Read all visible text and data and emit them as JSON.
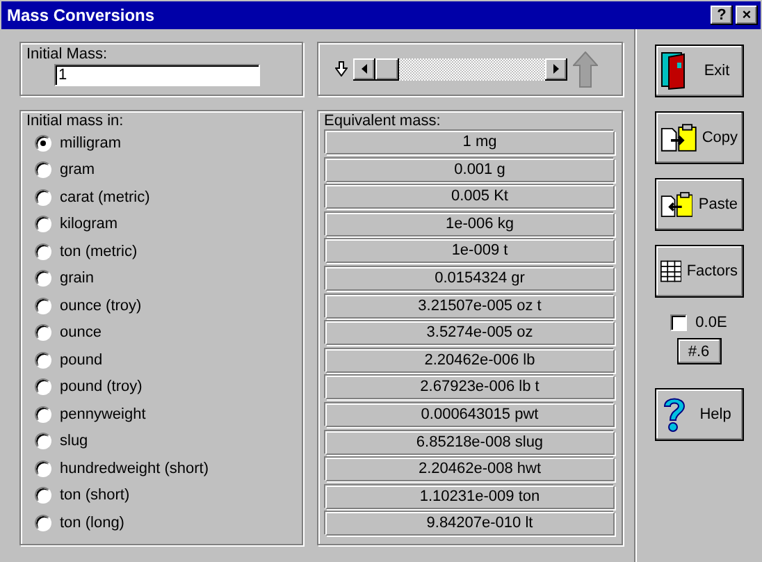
{
  "window": {
    "title": "Mass Conversions",
    "controls": [
      "?",
      "×"
    ]
  },
  "initial_mass": {
    "label": "Initial Mass:",
    "value": "1"
  },
  "slider": {
    "level": 0
  },
  "units": {
    "label": "Initial mass in:",
    "items": [
      {
        "label": "milligram",
        "selected": true
      },
      {
        "label": "gram",
        "selected": false
      },
      {
        "label": "carat (metric)",
        "selected": false
      },
      {
        "label": "kilogram",
        "selected": false
      },
      {
        "label": "ton (metric)",
        "selected": false
      },
      {
        "label": "grain",
        "selected": false
      },
      {
        "label": "ounce (troy)",
        "selected": false
      },
      {
        "label": "ounce",
        "selected": false
      },
      {
        "label": "pound",
        "selected": false
      },
      {
        "label": "pound (troy)",
        "selected": false
      },
      {
        "label": "pennyweight",
        "selected": false
      },
      {
        "label": "slug",
        "selected": false
      },
      {
        "label": "hundredweight (short)",
        "selected": false
      },
      {
        "label": "ton (short)",
        "selected": false
      },
      {
        "label": "ton (long)",
        "selected": false
      }
    ]
  },
  "results": {
    "label": "Equivalent mass:",
    "rows": [
      "1 mg",
      "0.001 g",
      "0.005 Kt",
      "1e-006 kg",
      "1e-009 t",
      "0.0154324 gr",
      "3.21507e-005 oz t",
      "3.5274e-005 oz",
      "2.20462e-006 lb",
      "2.67923e-006 lb t",
      "0.000643015 pwt",
      "6.85218e-008 slug",
      "2.20462e-008 hwt",
      "1.10231e-009 ton",
      "9.84207e-010 lt"
    ]
  },
  "buttons": [
    {
      "kind": "exit",
      "label": "Exit"
    },
    {
      "kind": "copy",
      "label": "Copy"
    },
    {
      "kind": "paste",
      "label": "Paste"
    },
    {
      "kind": "factors",
      "label": "Factors"
    }
  ],
  "format": {
    "label": "0.0E",
    "checked": false
  },
  "precision_button": "#.6",
  "help_button": {
    "kind": "help",
    "label": "Help"
  }
}
